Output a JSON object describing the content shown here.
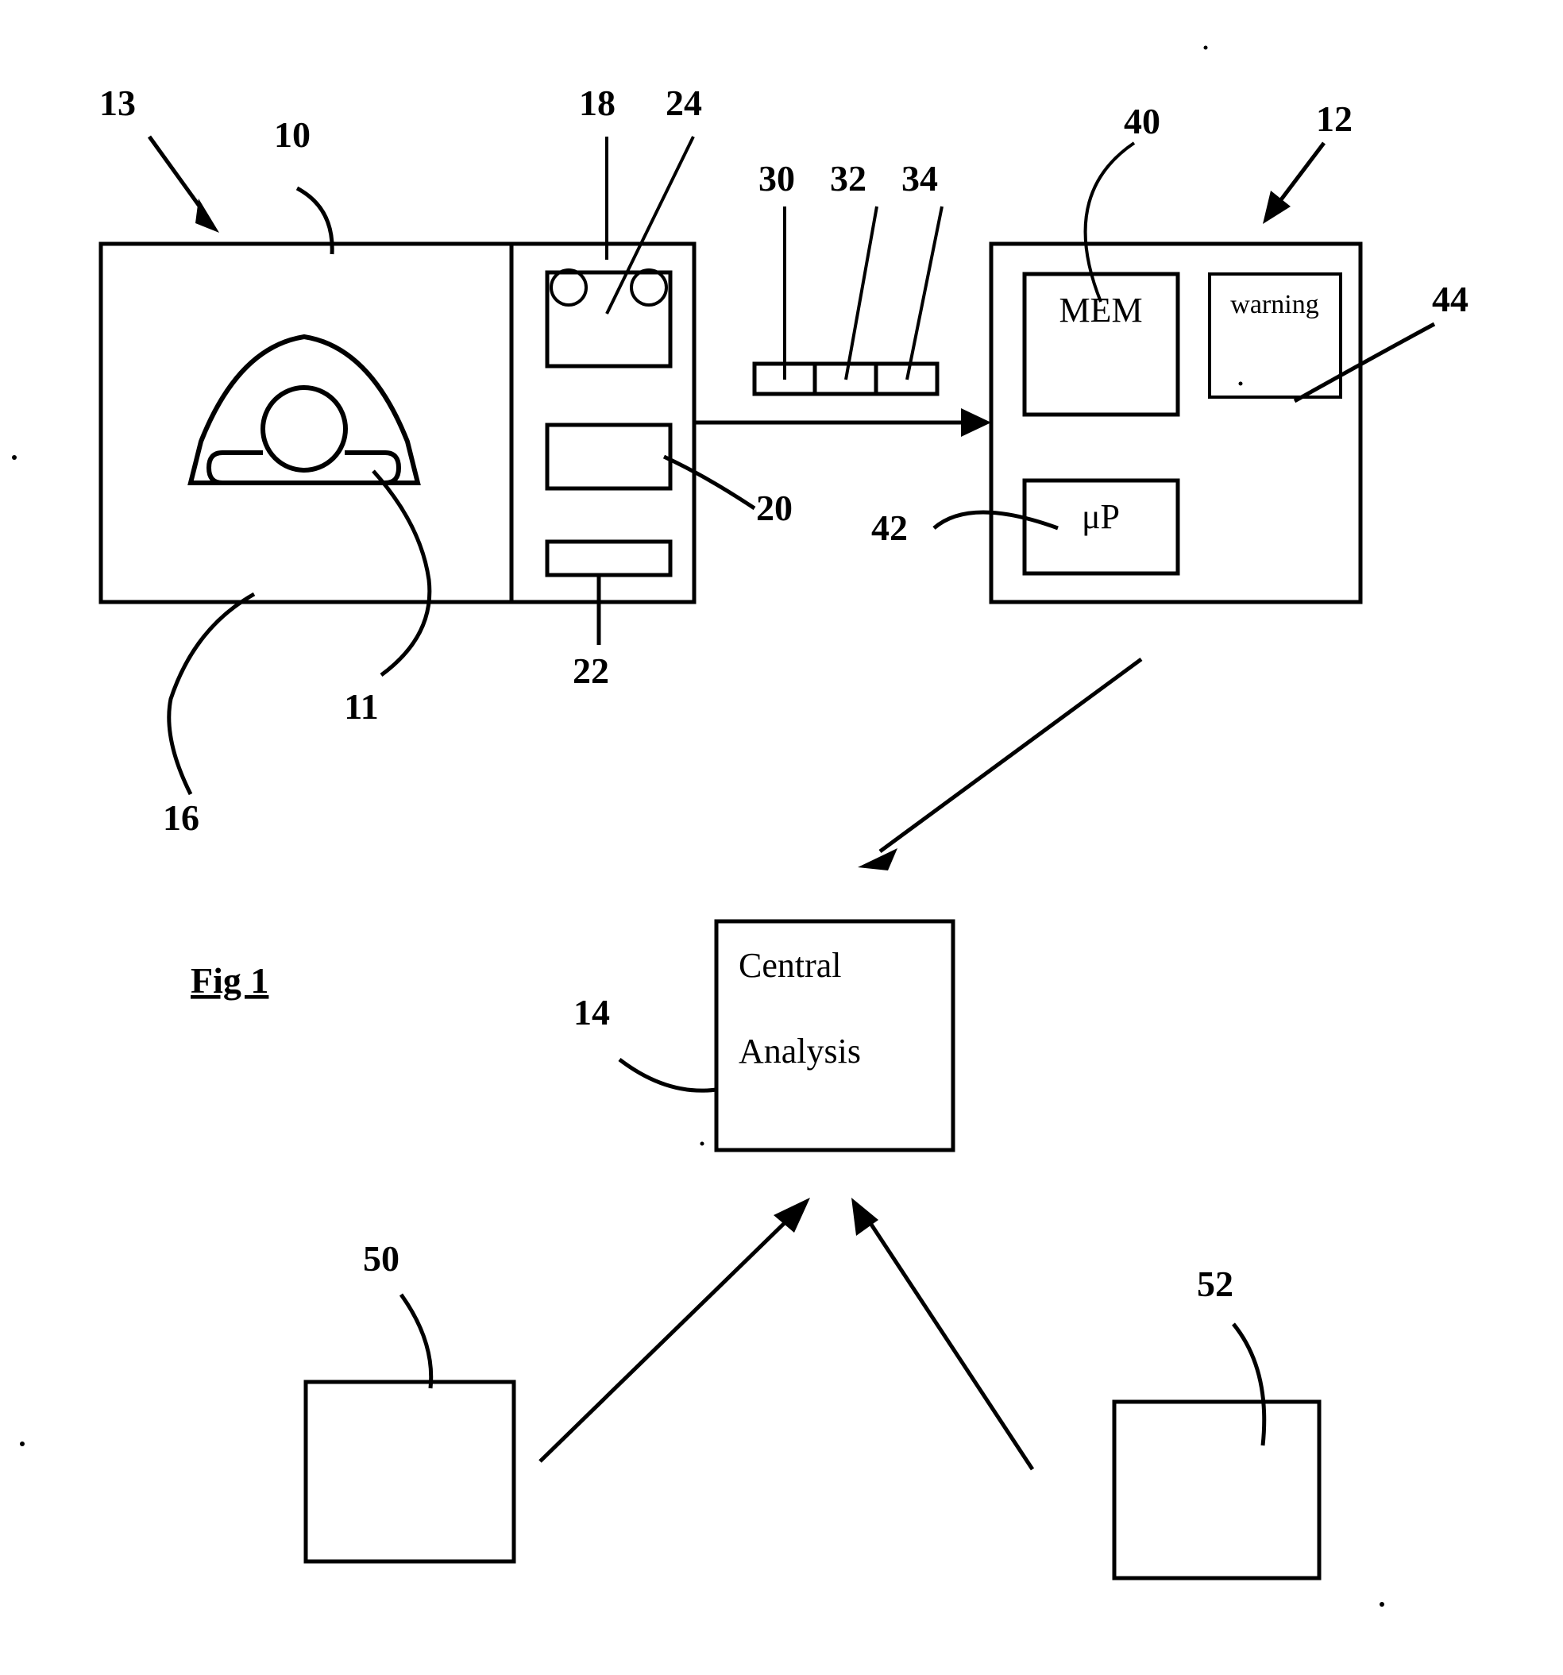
{
  "figure": {
    "caption": "Fig 1",
    "title_note": "Patent figure - system block diagram"
  },
  "reference_numerals": {
    "n13": "13",
    "n10": "10",
    "n18": "18",
    "n24": "24",
    "n30": "30",
    "n32": "32",
    "n34": "34",
    "n40": "40",
    "n12": "12",
    "n44": "44",
    "n20": "20",
    "n42": "42",
    "n22": "22",
    "n11": "11",
    "n16": "16",
    "n14": "14",
    "n50": "50",
    "n52": "52"
  },
  "blocks": {
    "device_assembly": {
      "name": "13",
      "patient_interface_ref": "10",
      "mask_ref": "16",
      "headgear_ref": "11"
    },
    "sensor_panel": {
      "module_top_ref": "18",
      "module_top_detail_ref": "24",
      "module_mid_ref": "20",
      "module_bottom_ref": "22"
    },
    "sensor_strip": {
      "cells": [
        "30",
        "32",
        "34"
      ]
    },
    "controller": {
      "ref": "12",
      "memory_label": "MEM",
      "memory_ref": "40",
      "warning_label": "warning",
      "warning_ref": "44",
      "processor_label": "μP",
      "processor_ref": "42"
    },
    "central_analysis": {
      "ref": "14",
      "line1": "Central",
      "line2": "Analysis"
    },
    "source_left": {
      "ref": "50"
    },
    "source_right": {
      "ref": "52"
    }
  },
  "colors": {
    "ink": "#000000",
    "paper": "#ffffff"
  }
}
